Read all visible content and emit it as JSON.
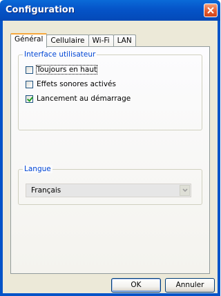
{
  "window": {
    "title": "Configuration"
  },
  "tabs": [
    {
      "label": "Général",
      "active": true
    },
    {
      "label": "Cellulaire",
      "active": false
    },
    {
      "label": "Wi-Fi",
      "active": false
    },
    {
      "label": "LAN",
      "active": false
    }
  ],
  "interface_group": {
    "legend": "Interface utilisateur",
    "options": [
      {
        "label": "Toujours en haut",
        "checked": false
      },
      {
        "label": "Effets sonores activés",
        "checked": false
      },
      {
        "label": "Lancement au démarrage",
        "checked": true
      }
    ]
  },
  "language_group": {
    "legend": "Langue",
    "selected": "Français"
  },
  "buttons": {
    "ok": "OK",
    "cancel": "Annuler"
  },
  "colors": {
    "titlebar": "#0554c8",
    "group_legend": "#0046d5",
    "close_button": "#e45b2f"
  },
  "icons": {
    "close": "close-icon",
    "dropdown": "chevron-down-icon",
    "checkmark": "check-icon"
  }
}
